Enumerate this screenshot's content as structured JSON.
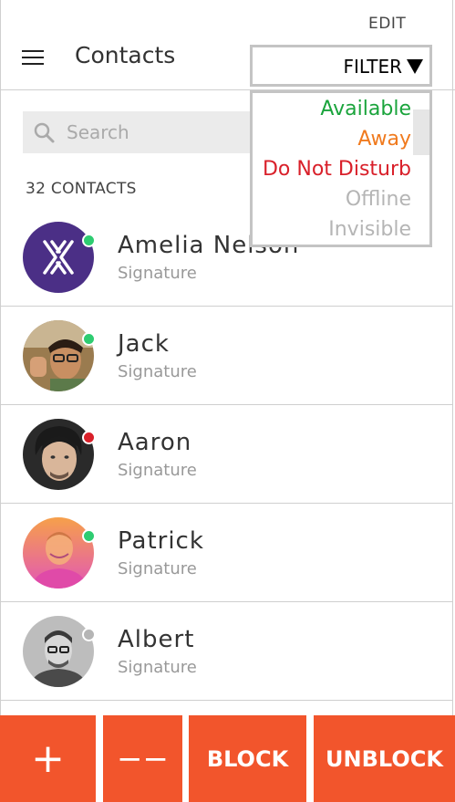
{
  "header": {
    "edit_label": "EDIT",
    "title": "Contacts",
    "menu_icon": "hamburger-menu-icon"
  },
  "filter": {
    "label": "FILTER",
    "arrow_icon": "triangle-down-icon",
    "options": [
      {
        "label": "Available",
        "color": "#1aa43c"
      },
      {
        "label": "Away",
        "color": "#f07a1e"
      },
      {
        "label": "Do Not Disturb",
        "color": "#d9202a"
      },
      {
        "label": "Offline",
        "color": "#b5b5b5"
      },
      {
        "label": "Invisible",
        "color": "#b5b5b5"
      }
    ]
  },
  "search": {
    "placeholder": "Search",
    "icon": "search-icon"
  },
  "contacts_count": "32 CONTACTS",
  "contacts": [
    {
      "name": "Amelia Nelson",
      "signature": "Signature",
      "status_color": "#2ecc71"
    },
    {
      "name": "Jack",
      "signature": "Signature",
      "status_color": "#2ecc71"
    },
    {
      "name": "Aaron",
      "signature": "Signature",
      "status_color": "#d9202a"
    },
    {
      "name": "Patrick",
      "signature": "Signature",
      "status_color": "#2ecc71"
    },
    {
      "name": "Albert",
      "signature": "Signature",
      "status_color": "#b5b5b5"
    }
  ],
  "actions": {
    "add_label": "+",
    "remove_label": "−−",
    "block_label": "BLOCK",
    "unblock_label": "UNBLOCK"
  },
  "colors": {
    "accent": "#f2552c"
  }
}
